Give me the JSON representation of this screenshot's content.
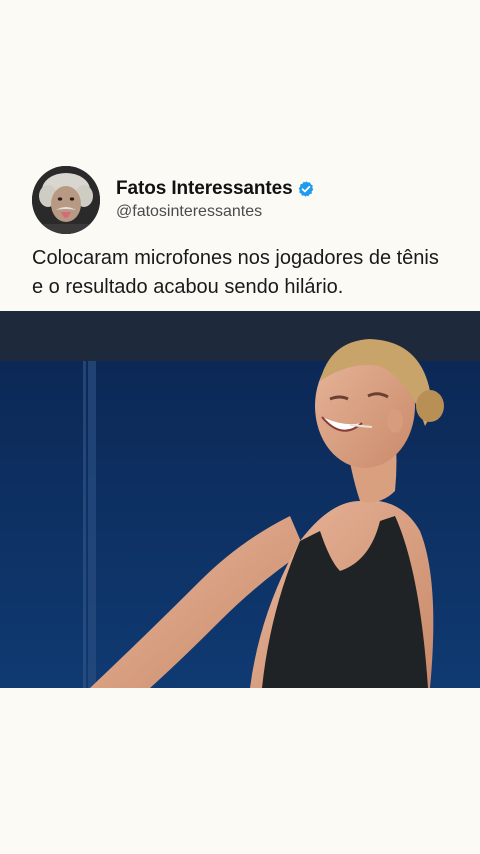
{
  "post": {
    "author_name": "Fatos Interessantes",
    "author_handle": "@fatosinteressantes",
    "verified": true,
    "text": "Colocaram microfones nos jogadores de tênis e o resultado acabou sendo hilário."
  },
  "colors": {
    "background": "#fbfaf5",
    "verified_badge": "#1d9bf0",
    "court_blue": "#0c2a5e"
  },
  "icons": {
    "verified": "verified-badge-icon"
  }
}
